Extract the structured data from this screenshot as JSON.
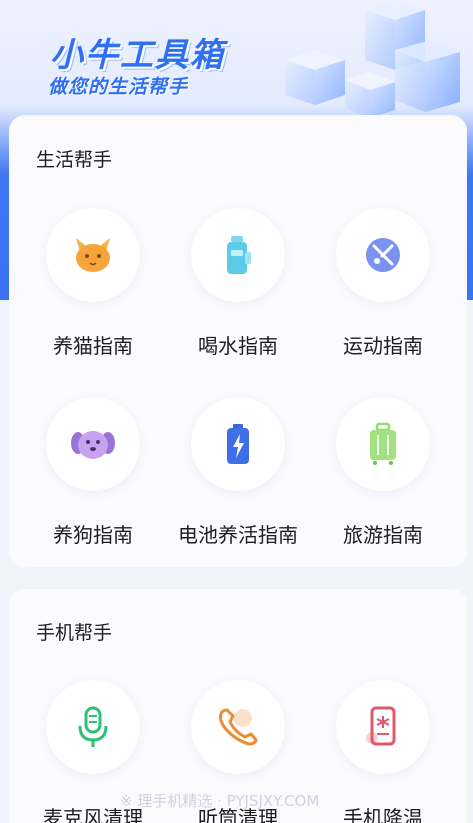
{
  "header": {
    "title": "小牛工具箱",
    "subtitle": "做您的生活帮手"
  },
  "sections": [
    {
      "title": "生活帮手",
      "items": [
        {
          "label": "养猫指南",
          "icon": "cat-icon"
        },
        {
          "label": "喝水指南",
          "icon": "water-bottle-icon"
        },
        {
          "label": "运动指南",
          "icon": "sports-tools-icon"
        },
        {
          "label": "养狗指南",
          "icon": "dog-icon"
        },
        {
          "label": "电池养活指南",
          "icon": "battery-icon"
        },
        {
          "label": "旅游指南",
          "icon": "suitcase-icon"
        }
      ]
    },
    {
      "title": "手机帮手",
      "items": [
        {
          "label": "麦克风清理",
          "icon": "microphone-icon"
        },
        {
          "label": "听筒清理",
          "icon": "phone-receiver-icon"
        },
        {
          "label": "手机降温",
          "icon": "phone-cooling-icon"
        }
      ]
    }
  ],
  "watermark": "※ 理手机精选 · PYJSJXY.COM",
  "colors": {
    "accent": "#2f6ff2",
    "hero_blue": "#3a73f2",
    "card_bg": "#fbfbfe",
    "text": "#1d1d1f"
  }
}
